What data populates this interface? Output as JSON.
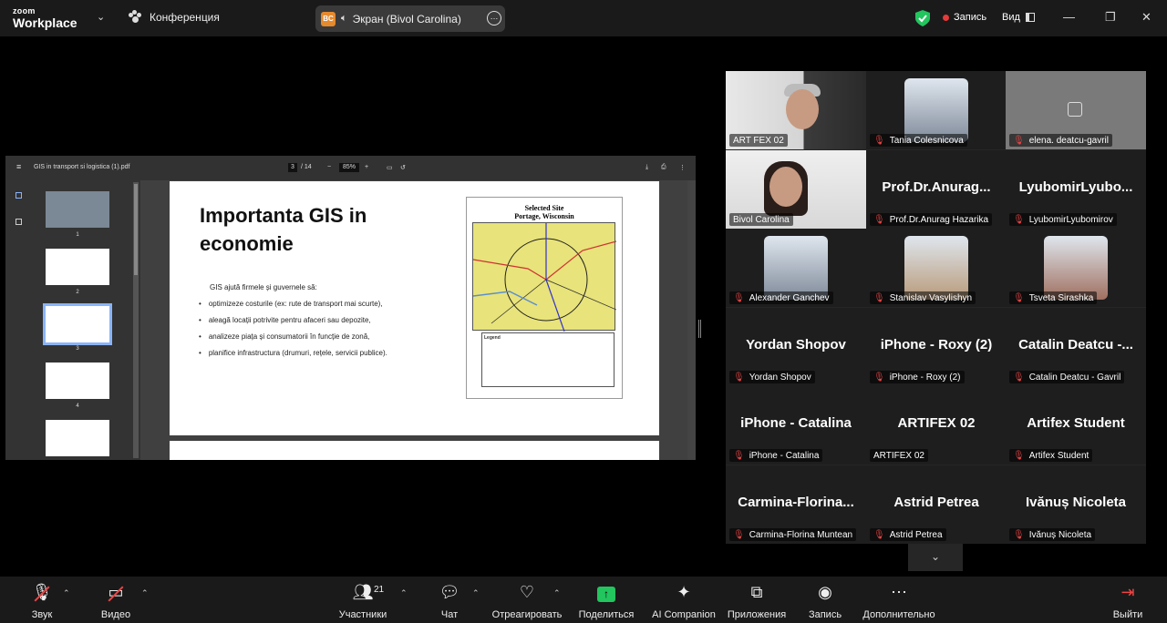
{
  "app": {
    "brand_line1": "zoom",
    "brand_line2": "Workplace",
    "meeting_title": "Конференция"
  },
  "share_pill": {
    "badge": "BC",
    "label": "Экран (Bivol Carolina)"
  },
  "top_right": {
    "recording": "Запись",
    "view": "Вид"
  },
  "pdf": {
    "filename": "GIS in transport si logistica (1).pdf",
    "current_page": "3",
    "total_pages": "/ 14",
    "zoom": "85%",
    "thumb_numbers": [
      "1",
      "2",
      "3",
      "4"
    ],
    "slide": {
      "title": "Importanta GIS in economie",
      "intro": "GIS ajută firmele și guvernele să:",
      "bullets": [
        "optimizeze costurile (ex: rute de transport mai scurte),",
        "aleagă locații potrivite pentru afaceri sau depozite,",
        "analizeze piața și consumatorii în funcție de zonă,",
        "planifice infrastructura (drumuri, rețele, servicii publice)."
      ],
      "map_title_1": "Selected Site",
      "map_title_2": "Portage, Wisconsin",
      "legend_title": "Legend"
    }
  },
  "participants": [
    {
      "name_label": "ART FEX 02",
      "big_name": "",
      "muted": false,
      "type": "video"
    },
    {
      "name_label": "Tania Colesnicova",
      "big_name": "",
      "muted": true,
      "type": "avatar"
    },
    {
      "name_label": "elena. deatcu-gavril",
      "big_name": "",
      "muted": true,
      "type": "empty"
    },
    {
      "name_label": "Bivol Carolina",
      "big_name": "",
      "muted": false,
      "type": "video"
    },
    {
      "name_label": "Prof.Dr.Anurag Hazarika",
      "big_name": "Prof.Dr.Anurag...",
      "muted": true,
      "type": "name"
    },
    {
      "name_label": "LyubomirLyubomirov",
      "big_name": "LyubomirLyubo...",
      "muted": true,
      "type": "name"
    },
    {
      "name_label": "Alexander Ganchev",
      "big_name": "",
      "muted": true,
      "type": "avatar"
    },
    {
      "name_label": "Stanislav Vasylishyn",
      "big_name": "",
      "muted": true,
      "type": "avatar"
    },
    {
      "name_label": "Tsveta Sirashka",
      "big_name": "",
      "muted": true,
      "type": "avatar"
    },
    {
      "name_label": "Yordan Shopov",
      "big_name": "Yordan Shopov",
      "muted": true,
      "type": "name"
    },
    {
      "name_label": "iPhone - Roxy (2)",
      "big_name": "iPhone - Roxy (2)",
      "muted": true,
      "type": "name"
    },
    {
      "name_label": "Catalin Deatcu - Gavril",
      "big_name": "Catalin Deatcu -...",
      "muted": true,
      "type": "name"
    },
    {
      "name_label": "iPhone - Catalina",
      "big_name": "iPhone - Catalina",
      "muted": true,
      "type": "name"
    },
    {
      "name_label": "ARTIFEX 02",
      "big_name": "ARTIFEX 02",
      "muted": false,
      "type": "name"
    },
    {
      "name_label": "Artifex Student",
      "big_name": "Artifex Student",
      "muted": true,
      "type": "name"
    },
    {
      "name_label": "Carmina-Florina Muntean",
      "big_name": "Carmina-Florina...",
      "muted": true,
      "type": "name"
    },
    {
      "name_label": "Astrid Petrea",
      "big_name": "Astrid Petrea",
      "muted": true,
      "type": "name"
    },
    {
      "name_label": "Ivănuș Nicoleta",
      "big_name": "Ivănuș Nicoleta",
      "muted": true,
      "type": "name"
    }
  ],
  "toolbar": {
    "audio": "Звук",
    "video": "Видео",
    "participants": "Участники",
    "participants_count": "21",
    "chat": "Чат",
    "react": "Отреагировать",
    "share": "Поделиться",
    "ai": "AI Companion",
    "apps": "Приложения",
    "record": "Запись",
    "more": "Дополнительно",
    "leave": "Выйти"
  },
  "colors": {
    "accent_green": "#22c55e",
    "mute_red": "#e44444",
    "active_outline": "#2ecc71"
  }
}
